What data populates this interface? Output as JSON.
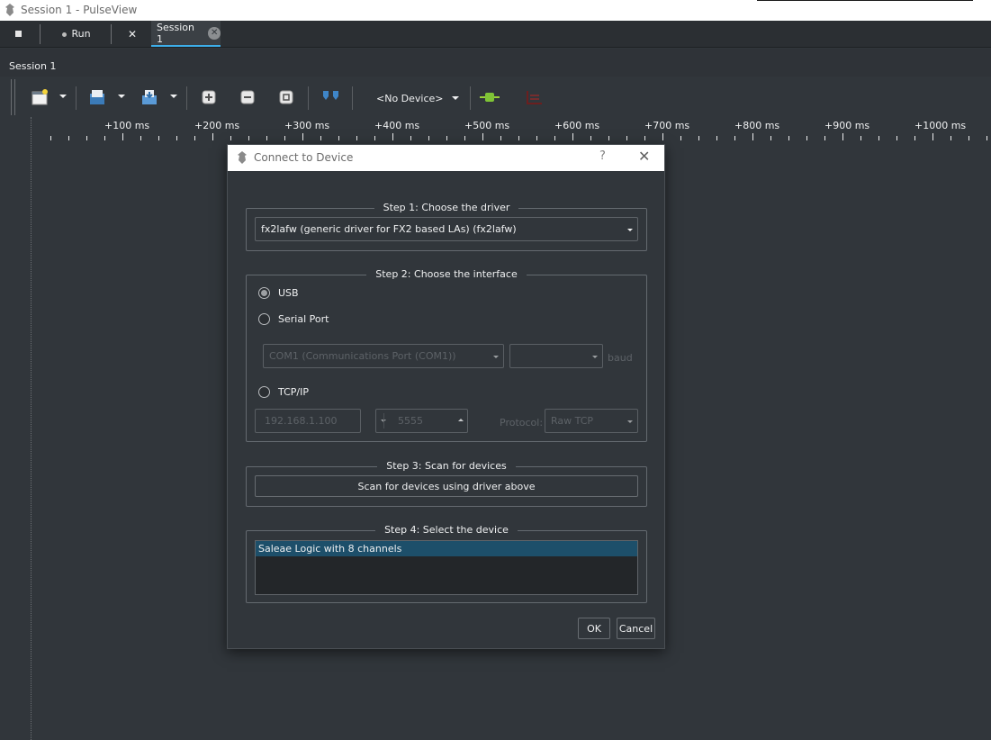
{
  "window": {
    "title": "Session 1 - PulseView"
  },
  "tabs": {
    "run_label": "Run",
    "tools_glyph": "✕",
    "session_label": "Session 1",
    "close_glyph": "✕"
  },
  "session": {
    "label": "Session 1"
  },
  "toolbar": {
    "device_selector": "<No Device>",
    "icons": [
      "new-view-icon",
      "open-icon",
      "save-icon",
      "zoom-in-icon",
      "zoom-out-icon",
      "zoom-fit-icon",
      "cursor-icon",
      "probe-config-icon",
      "decoder-icon"
    ]
  },
  "ruler": {
    "labels": [
      "+100 ms",
      "+200 ms",
      "+300 ms",
      "+400 ms",
      "+500 ms",
      "+600 ms",
      "+700 ms",
      "+800 ms",
      "+900 ms",
      "+1000 ms"
    ]
  },
  "dialog": {
    "title": "Connect to Device",
    "help": "?",
    "close": "✕",
    "step1": {
      "title": "Step 1: Choose the driver",
      "driver": "fx2lafw (generic driver for FX2 based LAs) (fx2lafw)"
    },
    "step2": {
      "title": "Step 2: Choose the interface",
      "usb": "USB",
      "serial": "Serial Port",
      "serial_port": "COM1 (Communications Port (COM1))",
      "baud_value": "",
      "baud_label": "baud",
      "tcpip": "TCP/IP",
      "host": "192.168.1.100",
      "port": "5555",
      "protocol_label": "Protocol:",
      "protocol": "Raw TCP"
    },
    "step3": {
      "title": "Step 3: Scan for devices",
      "scan_button": "Scan for devices using driver above"
    },
    "step4": {
      "title": "Step 4: Select the device",
      "devices": [
        "Saleae Logic with 8 channels"
      ]
    },
    "ok": "OK",
    "cancel": "Cancel"
  },
  "colors": {
    "background": "#31363b",
    "accent": "#3daee9",
    "selection": "#1d4f6a"
  }
}
